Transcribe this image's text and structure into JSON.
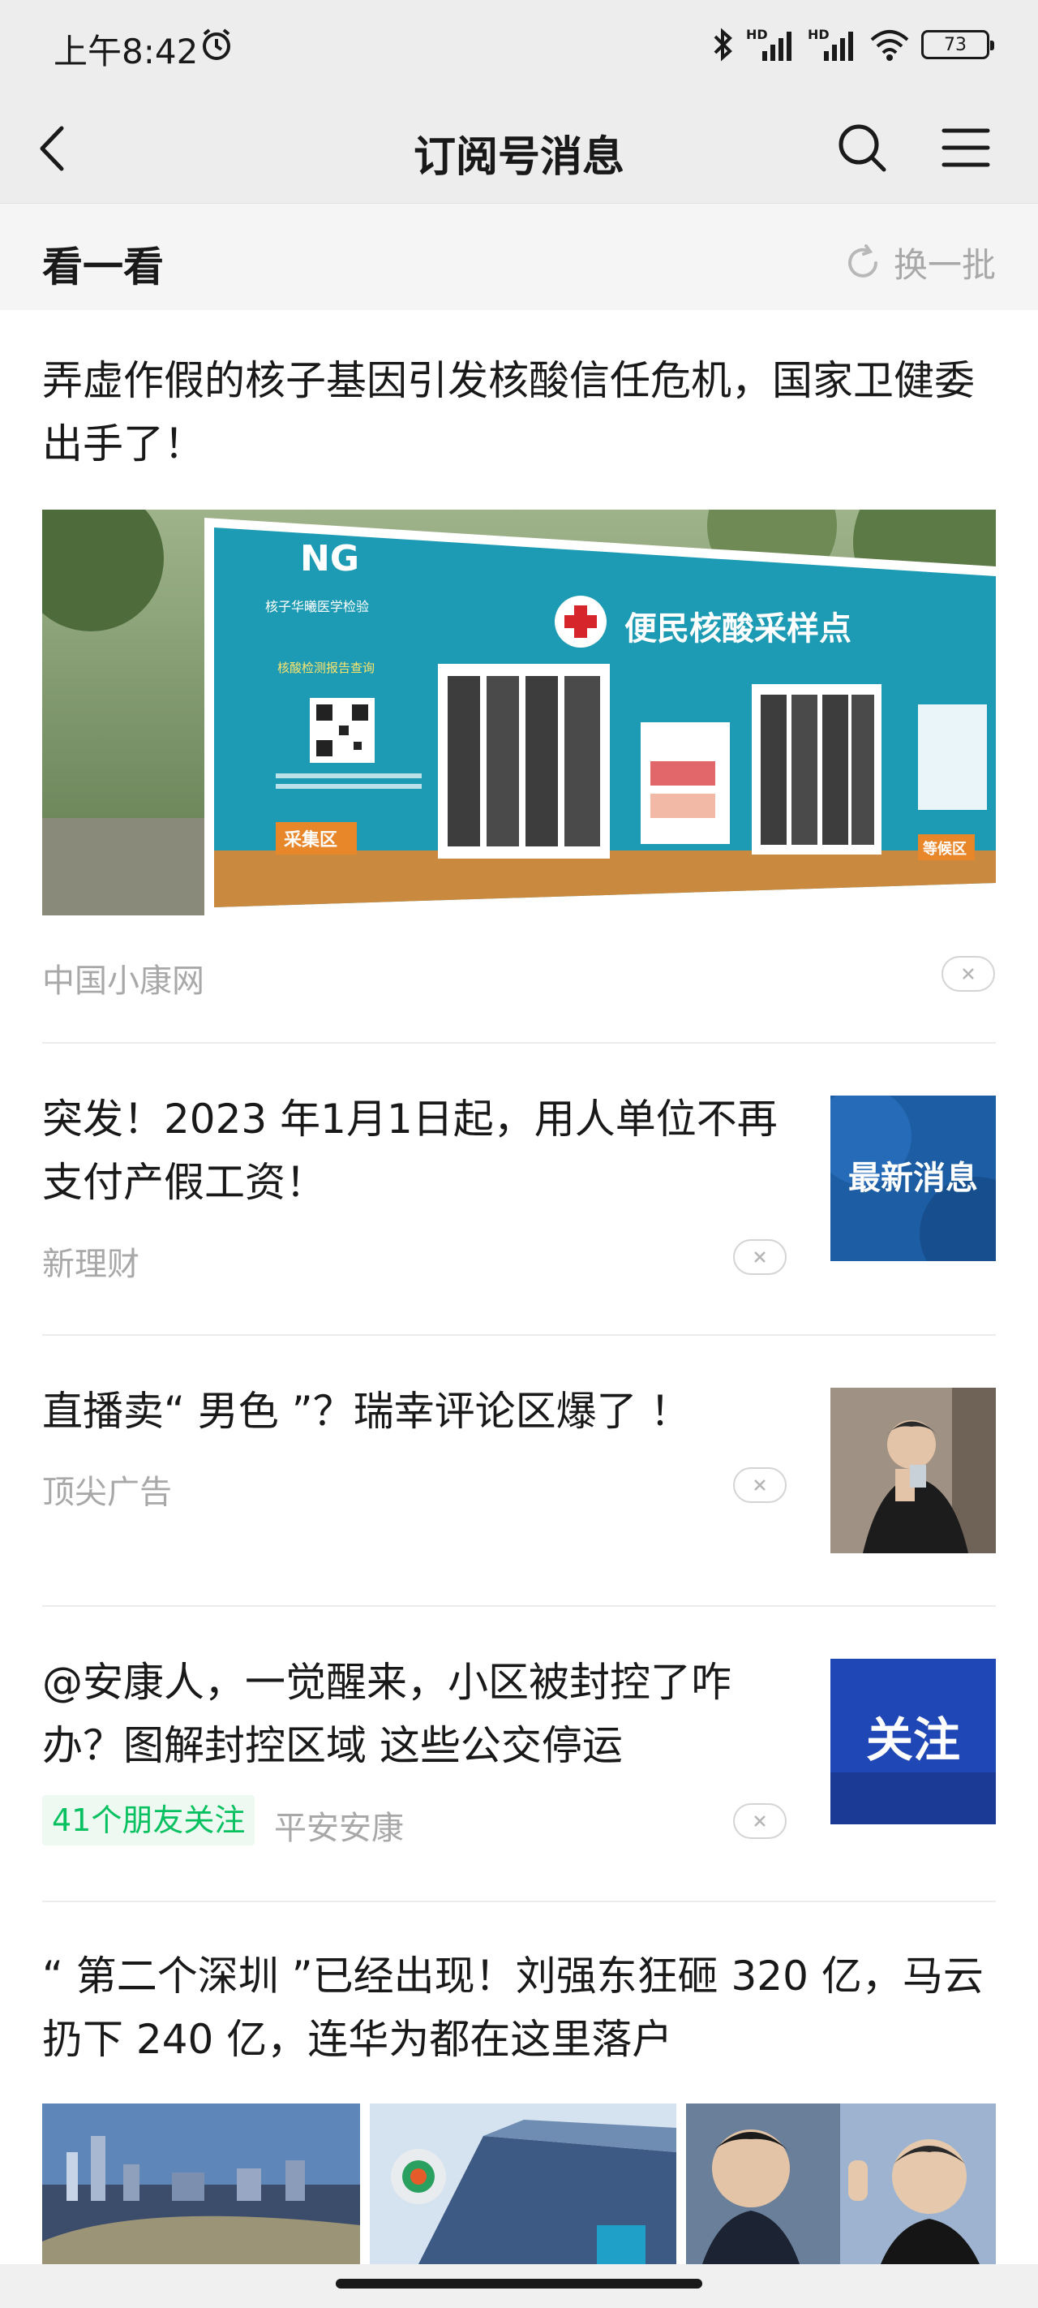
{
  "status": {
    "time": "上午8:42",
    "hd1": "HD",
    "hd2": "HD",
    "battery": "73"
  },
  "nav": {
    "title": "订阅号消息"
  },
  "section": {
    "title": "看一看",
    "refresh_label": "换一批"
  },
  "articles": [
    {
      "title": "弄虚作假的核子基因引发核酸信任危机，国家卫健委出手了！",
      "source": "中国小康网",
      "image_sign_text": "便民核酸采样点",
      "image_logo": "NG",
      "image_org": "核子华曦医学检验",
      "image_zone_left": "采集区",
      "image_zone_right": "等候区",
      "image_report": "核酸检测报告查询"
    },
    {
      "title": "突发！2023 年1月1日起，用人单位不再支付产假工资！",
      "source": "新理财",
      "thumb_text": "最新消息"
    },
    {
      "title": "直播卖“ 男色 ”？瑞幸评论区爆了 ！",
      "source": "顶尖广告"
    },
    {
      "title": "@安康人，一觉醒来，小区被封控了咋办？图解封控区域 这些公交停运",
      "friends_badge": "41个朋友关注",
      "source": "平安安康",
      "thumb_text": "关注"
    },
    {
      "title": "“ 第二个深圳 ”已经出现！刘强东狂砸 320 亿，马云扔下 240 亿，连华为都在这里落户"
    }
  ],
  "colors": {
    "header_bg": "#ededed",
    "accent_green": "#07c160",
    "meta_gray": "#a8a8a8"
  }
}
